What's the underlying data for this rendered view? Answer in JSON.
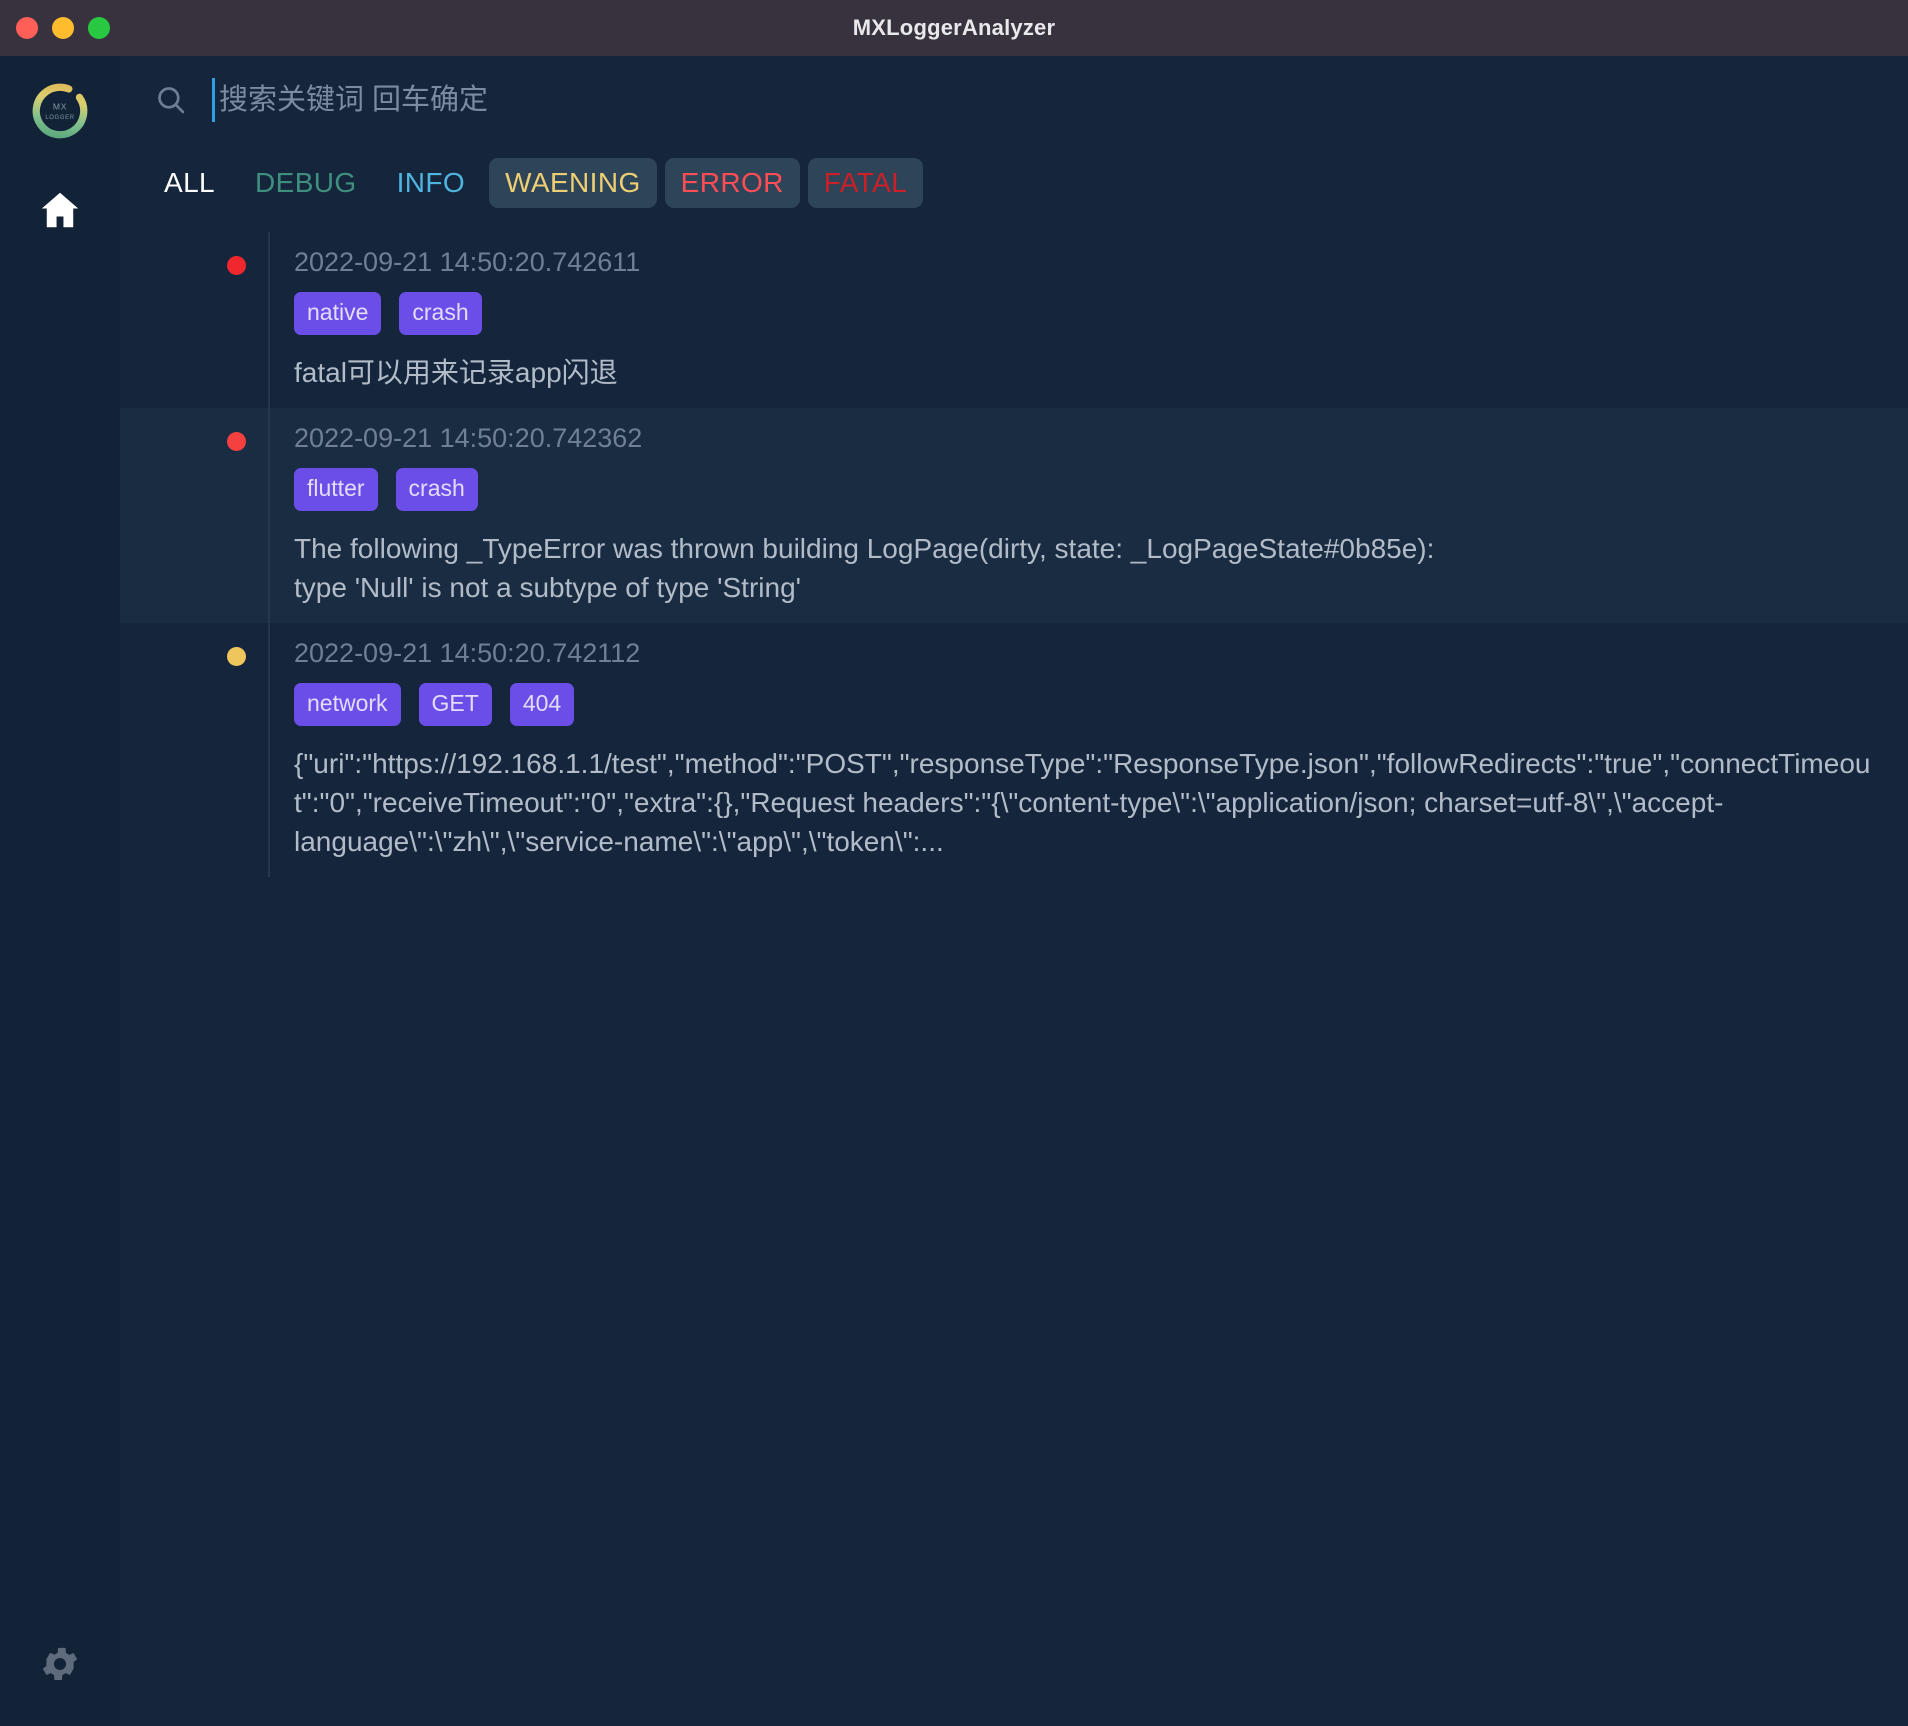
{
  "window": {
    "title": "MXLoggerAnalyzer",
    "traffic_lights": [
      "close-button",
      "minimize-button",
      "maximize-button"
    ]
  },
  "sidebar": {
    "logo": {
      "name": "mx-logger-logo",
      "line1": "MX",
      "line2": "LOGGER"
    },
    "items": [
      {
        "name": "home-icon",
        "label": "Home"
      },
      {
        "name": "gear-icon",
        "label": "Settings"
      }
    ]
  },
  "search": {
    "icon": "search-icon",
    "value": "",
    "placeholder": "搜索关键词 回车确定"
  },
  "tabs": [
    {
      "id": "all",
      "label": "ALL",
      "active": true,
      "chip": false,
      "color": "#ffffff"
    },
    {
      "id": "debug",
      "label": "DEBUG",
      "active": false,
      "chip": false,
      "color": "#3f8f7e"
    },
    {
      "id": "info",
      "label": "INFO",
      "active": false,
      "chip": false,
      "color": "#4fb4e0"
    },
    {
      "id": "warning",
      "label": "WAENING",
      "active": false,
      "chip": true,
      "color": "#edce73"
    },
    {
      "id": "error",
      "label": "ERROR",
      "active": false,
      "chip": true,
      "color": "#ff4d55"
    },
    {
      "id": "fatal",
      "label": "FATAL",
      "active": false,
      "chip": true,
      "color": "#cc1f27"
    }
  ],
  "logs": [
    {
      "level": "fatal",
      "bullet_color": "#f0282d",
      "timestamp": "2022-09-21 14:50:20.742611",
      "tags": [
        "native",
        "crash"
      ],
      "message": "fatal可以用来记录app闪退",
      "highlighted": false
    },
    {
      "level": "error",
      "bullet_color": "#f54040",
      "timestamp": "2022-09-21 14:50:20.742362",
      "tags": [
        "flutter",
        "crash"
      ],
      "message": "The following _TypeError was thrown building LogPage(dirty, state: _LogPageState#0b85e):\ntype 'Null' is not a subtype of type 'String'",
      "highlighted": true
    },
    {
      "level": "warning",
      "bullet_color": "#efc65c",
      "timestamp": "2022-09-21 14:50:20.742112",
      "tags": [
        "network",
        "GET",
        "404"
      ],
      "message": "{\"uri\":\"https://192.168.1.1/test\",\"method\":\"POST\",\"responseType\":\"ResponseType.json\",\"followRedirects\":\"true\",\"connectTimeout\":\"0\",\"receiveTimeout\":\"0\",\"extra\":{},\"Request headers\":\"{\\\"content-type\\\":\\\"application/json; charset=utf-8\\\",\\\"accept-language\\\":\\\"zh\\\",\\\"service-name\\\":\\\"app\\\",\\\"token\\\":...",
      "highlighted": false
    }
  ],
  "colors": {
    "window_chrome": "#37323d",
    "app_background": "#15263c",
    "sidebar_background": "#122338",
    "row_highlight": "#1a2c42",
    "tag_purple": "#6b4ee8",
    "caret_blue": "#2f9fe0",
    "timestamp_gray": "#6f8096",
    "message_gray": "#b2bcc8"
  }
}
